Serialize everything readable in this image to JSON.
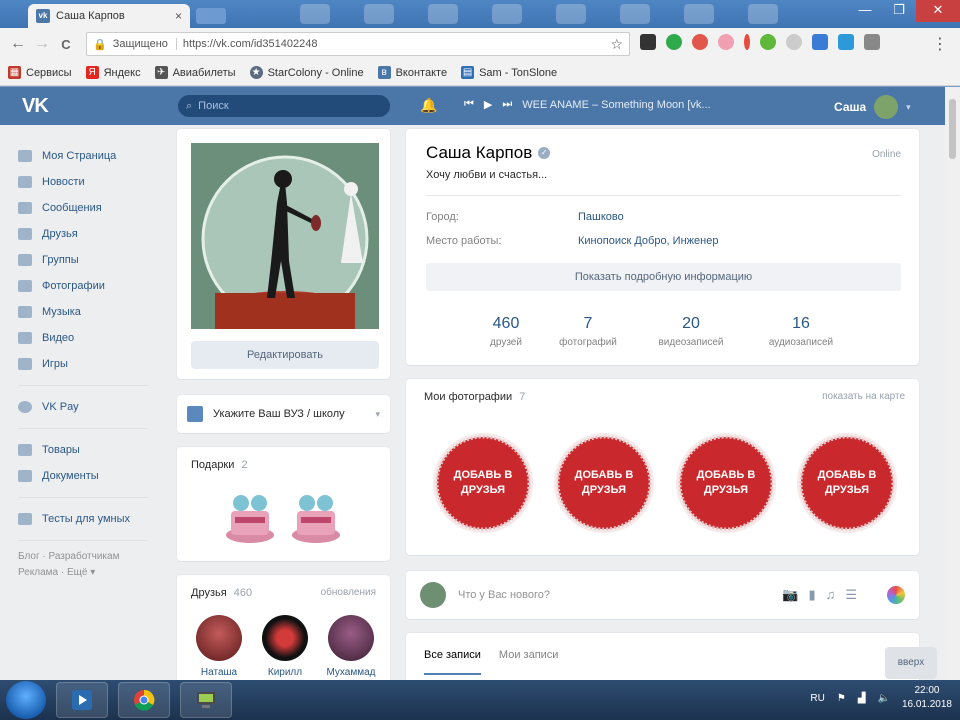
{
  "browser": {
    "tab_title": "Саша Карпов",
    "tab_close": "×",
    "window_min": "—",
    "window_max": "❐",
    "window_close": "✕",
    "back": "←",
    "forward": "→",
    "reload": "C",
    "secure_label": "Защищено",
    "url": "https://vk.com/id351402248",
    "bookmark_star": "☆",
    "menu": "⋮",
    "bookmarks": [
      {
        "label": "Сервисы",
        "color": "#c0392b"
      },
      {
        "label": "Яндекс",
        "color": "#e52620"
      },
      {
        "label": "Авиабилеты",
        "color": "#555555"
      },
      {
        "label": "StarColony - Online",
        "color": "#5a6b80"
      },
      {
        "label": "Вконтакте",
        "color": "#4a76a8"
      },
      {
        "label": "Sam - TonSlone",
        "color": "#2f6fb8"
      }
    ]
  },
  "vk": {
    "logo": "VK",
    "search_placeholder": "Поиск",
    "player": {
      "prev": "⏮",
      "play": "▶",
      "next": "⏭"
    },
    "track": "WEE ANAME – Something Moon [vk...",
    "user_name": "Саша",
    "dropdown": "▾",
    "nav": [
      {
        "label": "Моя Страница",
        "icon": "home-icon"
      },
      {
        "label": "Новости",
        "icon": "news-icon"
      },
      {
        "label": "Сообщения",
        "icon": "messages-icon"
      },
      {
        "label": "Друзья",
        "icon": "friends-icon"
      },
      {
        "label": "Группы",
        "icon": "groups-icon"
      },
      {
        "label": "Фотографии",
        "icon": "photos-icon"
      },
      {
        "label": "Музыка",
        "icon": "music-icon"
      },
      {
        "label": "Видео",
        "icon": "video-icon"
      },
      {
        "label": "Игры",
        "icon": "games-icon"
      }
    ],
    "nav_pay": "VK Pay",
    "nav_extra": [
      {
        "label": "Товары"
      },
      {
        "label": "Документы"
      }
    ],
    "nav_tests": "Тесты для умных",
    "nav_footer": "Блог · Разработчикам Реклама · Ещё ▾",
    "edit_button": "Редактировать",
    "school_prompt": "Укажите Ваш ВУЗ / школу",
    "school_chevron": "▾",
    "gifts_title": "Подарки",
    "gifts_count": "2",
    "friends_title": "Друзья",
    "friends_count": "460",
    "friends_link": "обновления",
    "friends": [
      {
        "name": "Наташа",
        "color": "#8b2a2a"
      },
      {
        "name": "Кирилл",
        "color": "#1a1a1a"
      },
      {
        "name": "Мухаммад",
        "color": "#6a3c5a"
      }
    ],
    "profile": {
      "name": "Саша Карпов",
      "status": "Хочу любви и счастья...",
      "online": "Online",
      "city_label": "Город:",
      "city_value": "Пашково",
      "work_label": "Место работы:",
      "work_value": "Кинопоиск Добро, Инженер",
      "more_info": "Показать подробную информацию",
      "counters": [
        {
          "n": "460",
          "l": "друзей"
        },
        {
          "n": "7",
          "l": "фотографий"
        },
        {
          "n": "20",
          "l": "видеозаписей"
        },
        {
          "n": "16",
          "l": "аудиозаписей"
        }
      ]
    },
    "photos_title": "Мои фотографии",
    "photos_count": "7",
    "photos_link": "показать на карте",
    "photo_badges": [
      "ДОБАВЬ В ДРУЗЬЯ",
      "ДОБАВЬ В ДРУЗЬЯ",
      "ДОБАВЬ В ДРУЗЬЯ",
      "ДОБАВЬ В ДРУЗЬЯ"
    ],
    "composer_placeholder": "Что у Вас нового?",
    "composer_tools": [
      "📷",
      "▮",
      "♫",
      "☰"
    ],
    "wall_tabs": {
      "all": "Все записи",
      "mine": "Мои записи"
    },
    "scroll_up": "вверх"
  },
  "taskbar": {
    "lang": "RU",
    "time": "22:00",
    "date": "16.01.2018"
  },
  "colors": {
    "vk_blue": "#4a76a8",
    "badge_red": "#c9282d",
    "link": "#2a5885"
  }
}
